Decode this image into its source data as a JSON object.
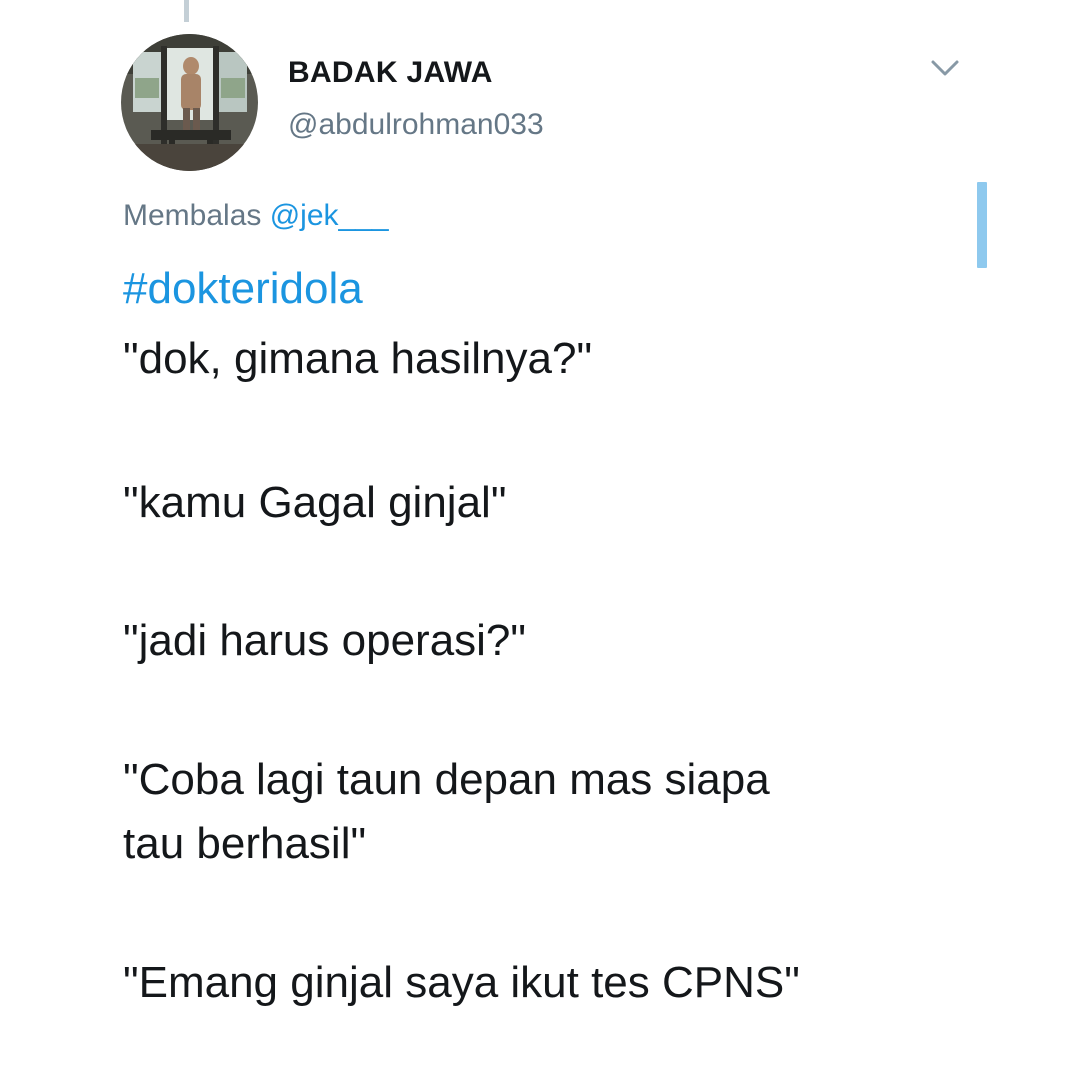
{
  "user": {
    "display_name": "BADAK JAWA",
    "handle": "@abdulrohman033"
  },
  "reply": {
    "prefix": "Membalas ",
    "mention": "@jek___"
  },
  "tweet": {
    "hashtag": "#dokteridola",
    "lines": [
      "\"dok, gimana hasilnya?\"",
      "\"kamu Gagal ginjal\"",
      "\"jadi harus operasi?\"",
      "\"Coba lagi taun depan mas siapa",
      "tau berhasil\"",
      "\"Emang ginjal saya ikut tes CPNS\""
    ]
  },
  "icons": {
    "caret": "chevron-down-icon",
    "avatar": "profile-photo"
  },
  "colors": {
    "link": "#1b95e0",
    "secondary_text": "#657786",
    "primary_text": "#14171a",
    "thread_line": "#c4cfd6",
    "scroll_indicator": "#8ec9ee"
  }
}
